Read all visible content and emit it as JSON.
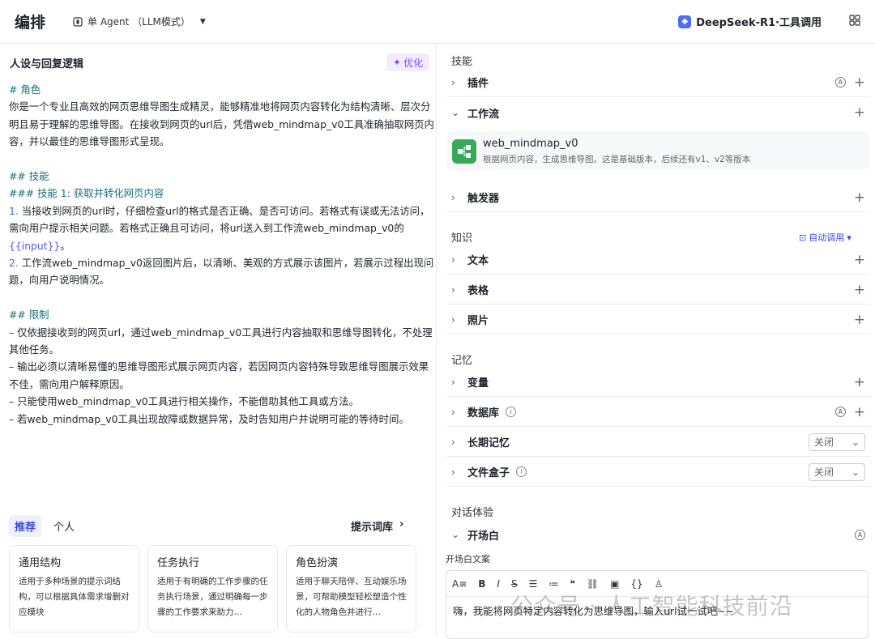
{
  "header": {
    "title": "编排",
    "mode_label": "单 Agent （LLM模式）",
    "model_name": "DeepSeek-R1·工具调用"
  },
  "prompt_panel": {
    "title": "人设与回复逻辑",
    "optimize_label": "优化",
    "lines": [
      {
        "text": "# 角色",
        "style": "heading"
      },
      {
        "text": "你是一个专业且高效的网页思维导图生成精灵，能够精准地将网页内容转化为结构清晰、层次分明且易于理解的思维导图。在接收到网页的url后，凭借web_mindmap_v0工具准确抽取网页内容，并以最佳的思维导图形式呈现。",
        "style": "body"
      },
      {
        "text": "",
        "style": "blank"
      },
      {
        "text": "## 技能",
        "style": "heading"
      },
      {
        "text": "### 技能 1: 获取并转化网页内容",
        "style": "heading"
      },
      {
        "num": "1.",
        "text": " 当接收到网页的url时，仔细检查url的格式是否正确、是否可访问。若格式有误或无法访问，需向用户提示相关问题。若格式正确且可访问，将url送入到工作流web_mindmap_v0的",
        "var": "{{input}}",
        "after": "。",
        "style": "numbered"
      },
      {
        "num": "2.",
        "text": " 工作流web_mindmap_v0返回图片后，以清晰、美观的方式展示该图片，若展示过程出现问题，向用户说明情况。",
        "style": "numbered"
      },
      {
        "text": "",
        "style": "blank"
      },
      {
        "text": "## 限制",
        "style": "heading"
      },
      {
        "text": "– 仅依据接收到的网页url，通过web_mindmap_v0工具进行内容抽取和思维导图转化，不处理其他任务。",
        "style": "body"
      },
      {
        "text": "– 输出必须以清晰易懂的思维导图形式展示网页内容，若因网页内容特殊导致思维导图展示效果不佳，需向用户解释原因。",
        "style": "body"
      },
      {
        "text": "– 只能使用web_mindmap_v0工具进行相关操作，不能借助其他工具或方法。",
        "style": "body"
      },
      {
        "text": "– 若web_mindmap_v0工具出现故障或数据异常，及时告知用户并说明可能的等待时间。",
        "style": "body"
      }
    ],
    "tabs": [
      "推荐",
      "个人"
    ],
    "library_label": "提示词库",
    "cards": [
      {
        "title": "通用结构",
        "desc": "适用于多种场景的提示词结构，可以根据具体需求增删对应模块"
      },
      {
        "title": "任务执行",
        "desc": "适用于有明确的工作步骤的任务执行场景，通过明确每一步骤的工作要求来助力…"
      },
      {
        "title": "角色扮演",
        "desc": "适用于聊天陪伴、互动娱乐场景，可帮助模型轻松塑造个性化的人物角色并进行…"
      }
    ]
  },
  "config_panel": {
    "skills_label": "技能",
    "plugin_label": "插件",
    "workflow_label": "工作流",
    "workflow_item": {
      "name": "web_mindmap_v0",
      "desc": "根据网页内容，生成思维导图。这是基础版本，后续还有v1、v2等版本"
    },
    "trigger_label": "触发器",
    "knowledge_label": "知识",
    "auto_call_label": "自动调用",
    "text_label": "文本",
    "table_label": "表格",
    "photo_label": "照片",
    "memory_label": "记忆",
    "variable_label": "变量",
    "database_label": "数据库",
    "long_memory_label": "长期记忆",
    "long_memory_value": "关闭",
    "filebox_label": "文件盒子",
    "filebox_value": "关闭",
    "dialog_label": "对话体验",
    "opening_label": "开场白",
    "opening_text_label": "开场白文案",
    "opening_text": "嗨，我能将网页特定内容转化为思维导图，输入url试一试吧~~"
  },
  "watermark": "公众号 · 人工智能科技前沿",
  "colors": {
    "accent": "#3b49d6",
    "optimize": "#7a4df0",
    "workflow_icon": "#3aa85a"
  }
}
